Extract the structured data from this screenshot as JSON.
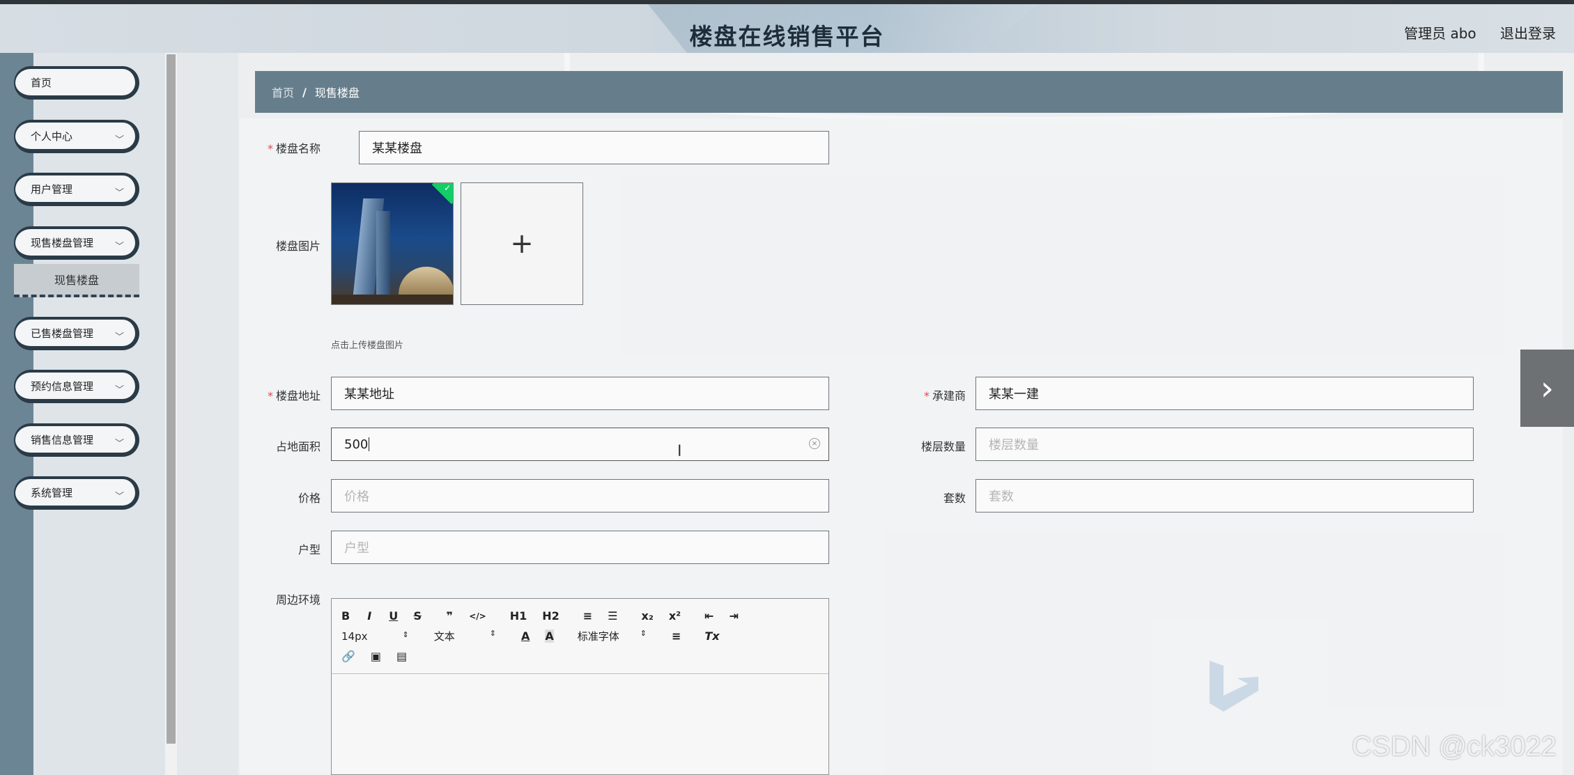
{
  "header": {
    "title": "楼盘在线销售平台",
    "user_role": "管理员 abo",
    "logout": "退出登录"
  },
  "sidebar": {
    "items": [
      {
        "label": "首页",
        "has_arrow": false
      },
      {
        "label": "个人中心",
        "has_arrow": true
      },
      {
        "label": "用户管理",
        "has_arrow": true
      },
      {
        "label": "现售楼盘管理",
        "has_arrow": true
      },
      {
        "label": "已售楼盘管理",
        "has_arrow": true
      },
      {
        "label": "预约信息管理",
        "has_arrow": true
      },
      {
        "label": "销售信息管理",
        "has_arrow": true
      },
      {
        "label": "系统管理",
        "has_arrow": true
      }
    ],
    "active_submenu": "现售楼盘"
  },
  "breadcrumb": {
    "home": "首页",
    "separator": "/",
    "current": "现售楼盘"
  },
  "form": {
    "name": {
      "label": "楼盘名称",
      "value": "某某楼盘",
      "required": true
    },
    "image": {
      "label": "楼盘图片",
      "upload_hint": "点击上传楼盘图片",
      "add_symbol": "+"
    },
    "address": {
      "label": "楼盘地址",
      "value": "某某地址",
      "required": true
    },
    "contractor": {
      "label": "承建商",
      "value": "某某一建",
      "required": true
    },
    "area": {
      "label": "占地面积",
      "value": "500"
    },
    "floors": {
      "label": "楼层数量",
      "placeholder": "楼层数量"
    },
    "price": {
      "label": "价格",
      "placeholder": "价格"
    },
    "units": {
      "label": "套数",
      "placeholder": "套数"
    },
    "layout": {
      "label": "户型",
      "placeholder": "户型"
    },
    "surroundings": {
      "label": "周边环境"
    }
  },
  "editor_toolbar": {
    "row1": [
      "B",
      "I",
      "U",
      "S",
      "❞",
      "</>",
      "H1",
      "H2",
      "≡",
      "☰",
      "x₂",
      "x²",
      "⇤",
      "⇥"
    ],
    "font_size": "14px",
    "text_style": "文本",
    "font_color": "A",
    "bg_color": "A",
    "font_family": "标准字体",
    "align": "≡",
    "clear": "Tx",
    "row3_icons": [
      "link-icon",
      "image-icon",
      "video-icon"
    ]
  },
  "watermark": "CSDN @ck3022",
  "colors": {
    "breadcrumb_bg": "#667e8b",
    "sidebar_border": "#2a3b47",
    "required": "#e4464d",
    "upload_success": "#13ce66"
  }
}
